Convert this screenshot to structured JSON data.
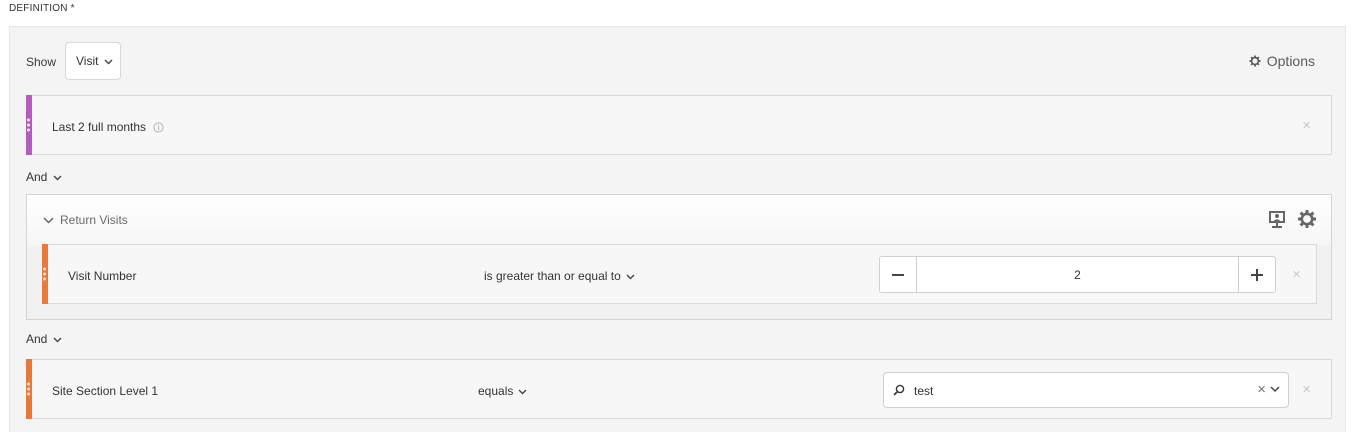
{
  "section_title": "DEFINITION *",
  "show": {
    "label": "Show",
    "selected": "Visit"
  },
  "options_label": "Options",
  "rule1": {
    "label": "Last 2 full months",
    "bar_color": "#b25dbb"
  },
  "and1": "And",
  "container": {
    "title": "Return Visits",
    "rule": {
      "label": "Visit Number",
      "operator": "is greater than or equal to",
      "value": "2",
      "bar_color": "#e8793a"
    }
  },
  "and2": "And",
  "rule3": {
    "label": "Site Section Level 1",
    "operator": "equals",
    "search_value": "test",
    "bar_color": "#e8793a"
  },
  "close_glyph": "×"
}
